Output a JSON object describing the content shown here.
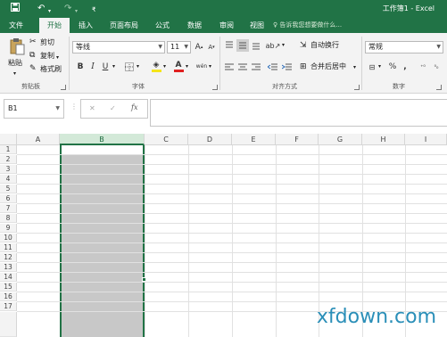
{
  "titlebar": {
    "title": "工作簿1 - Excel",
    "save_icon": "save-icon",
    "undo_icon": "undo-icon",
    "redo_icon": "redo-icon",
    "customize_icon": "customize-qat-icon"
  },
  "tabs": [
    "文件",
    "开始",
    "插入",
    "页面布局",
    "公式",
    "数据",
    "审阅",
    "视图"
  ],
  "active_tab": "开始",
  "tell_me": "告诉我您想要做什么...",
  "ribbon": {
    "clipboard": {
      "label": "剪贴板",
      "paste": "粘贴",
      "cut": "剪切",
      "copy": "复制",
      "format_painter": "格式刷"
    },
    "font": {
      "label": "字体",
      "font_name": "等线",
      "font_size": "11",
      "bold": "B",
      "italic": "I",
      "underline": "U",
      "grow": "A",
      "shrink": "A",
      "phonetic": "wén"
    },
    "alignment": {
      "label": "对齐方式",
      "wrap_text": "自动换行",
      "merge_center": "合并后居中"
    },
    "number": {
      "label": "数字",
      "format": "常规",
      "percent": "%",
      "comma": ","
    }
  },
  "formula_bar": {
    "name_box": "B1",
    "cancel": "✕",
    "enter": "✓",
    "fx": "fx",
    "content": ""
  },
  "grid": {
    "columns": [
      "A",
      "B",
      "C",
      "D",
      "E",
      "F",
      "G",
      "H",
      "I"
    ],
    "rows": [
      "1",
      "2",
      "3",
      "4",
      "5",
      "6",
      "7",
      "8",
      "9",
      "10",
      "11",
      "12",
      "13",
      "14",
      "15",
      "16",
      "17"
    ],
    "selected_column": "B",
    "active_cell": "B1"
  },
  "colors": {
    "accent": "#217346",
    "selection": "#c8c8c8"
  },
  "watermark": "xfdown.com"
}
